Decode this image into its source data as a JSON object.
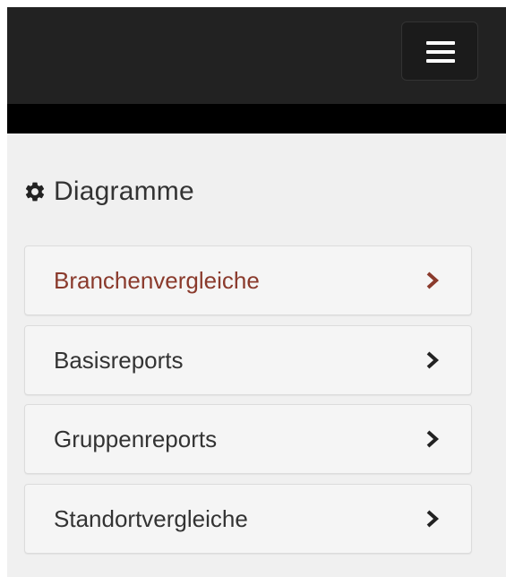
{
  "navbar": {
    "toggle_icon": "hamburger-menu-icon",
    "background": "#222222"
  },
  "section": {
    "icon": "gear-icon",
    "title": "Diagramme"
  },
  "menu": {
    "items": [
      {
        "label": "Branchenvergleiche",
        "active": true,
        "color": "#8a3a2c",
        "icon": "chevron-right-icon"
      },
      {
        "label": "Basisreports",
        "active": false,
        "color": "#222222",
        "icon": "chevron-right-icon"
      },
      {
        "label": "Gruppenreports",
        "active": false,
        "color": "#222222",
        "icon": "chevron-right-icon"
      },
      {
        "label": "Standortvergleiche",
        "active": false,
        "color": "#222222",
        "icon": "chevron-right-icon"
      }
    ]
  }
}
